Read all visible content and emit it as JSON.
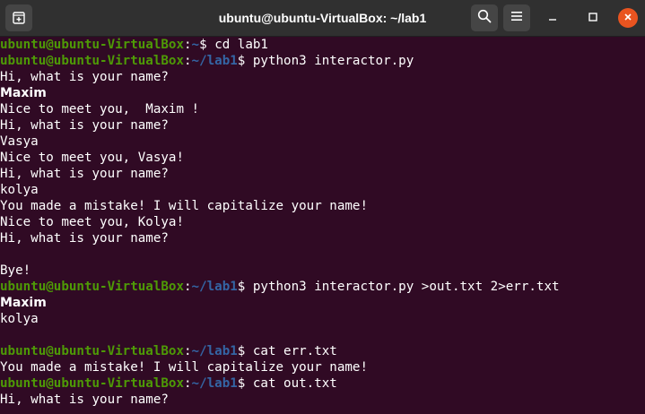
{
  "window": {
    "title": "ubuntu@ubuntu-VirtualBox: ~/lab1"
  },
  "colors": {
    "terminal_bg": "#300a24",
    "titlebar_bg": "#303030",
    "prompt_user": "#4e9a06",
    "prompt_path": "#3465a4",
    "close_button": "#e95420"
  },
  "icons": {
    "new_tab": "new-tab-icon",
    "search": "search-icon",
    "menu": "hamburger-menu-icon",
    "minimize": "minimize-icon",
    "maximize": "maximize-icon",
    "close": "close-icon"
  },
  "terminal": {
    "lines": [
      {
        "type": "prompt",
        "user": "ubuntu@ubuntu-VirtualBox",
        "sep": ":",
        "path": "~",
        "sym": "$ ",
        "cmd": "cd lab1"
      },
      {
        "type": "prompt",
        "user": "ubuntu@ubuntu-VirtualBox",
        "sep": ":",
        "path": "~/lab1",
        "sym": "$ ",
        "cmd": "python3 interactor.py"
      },
      {
        "type": "out",
        "text": "Hi, what is your name?"
      },
      {
        "type": "in",
        "text": "Maxim"
      },
      {
        "type": "out",
        "text": "Nice to meet you,  Maxim !"
      },
      {
        "type": "out",
        "text": "Hi, what is your name?"
      },
      {
        "type": "out",
        "text": "Vasya"
      },
      {
        "type": "out",
        "text": "Nice to meet you, Vasya!"
      },
      {
        "type": "out",
        "text": "Hi, what is your name?"
      },
      {
        "type": "out",
        "text": "kolya"
      },
      {
        "type": "out",
        "text": "You made a mistake! I will capitalize your name!"
      },
      {
        "type": "out",
        "text": "Nice to meet you, Kolya!"
      },
      {
        "type": "out",
        "text": "Hi, what is your name?"
      },
      {
        "type": "out",
        "text": ""
      },
      {
        "type": "out",
        "text": "Bye!"
      },
      {
        "type": "prompt",
        "user": "ubuntu@ubuntu-VirtualBox",
        "sep": ":",
        "path": "~/lab1",
        "sym": "$ ",
        "cmd": "python3 interactor.py >out.txt 2>err.txt"
      },
      {
        "type": "in",
        "text": "Maxim"
      },
      {
        "type": "out",
        "text": "kolya"
      },
      {
        "type": "out",
        "text": ""
      },
      {
        "type": "prompt",
        "user": "ubuntu@ubuntu-VirtualBox",
        "sep": ":",
        "path": "~/lab1",
        "sym": "$ ",
        "cmd": "cat err.txt"
      },
      {
        "type": "out",
        "text": "You made a mistake! I will capitalize your name!"
      },
      {
        "type": "prompt",
        "user": "ubuntu@ubuntu-VirtualBox",
        "sep": ":",
        "path": "~/lab1",
        "sym": "$ ",
        "cmd": "cat out.txt"
      },
      {
        "type": "out",
        "text": "Hi, what is your name?"
      }
    ]
  }
}
